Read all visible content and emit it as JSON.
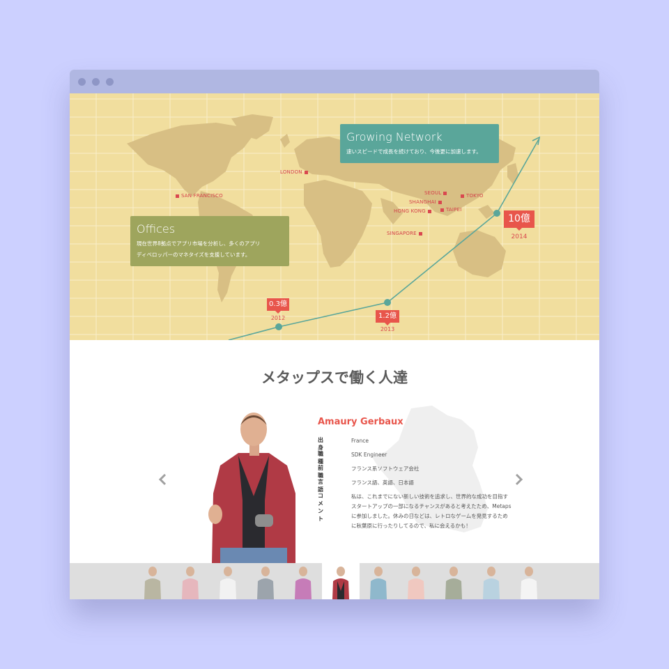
{
  "window": {
    "controls": [
      "close",
      "minimize",
      "maximize"
    ]
  },
  "hero": {
    "offices": {
      "title": "Offices",
      "desc_line1": "現在世界8拠点でアプリ市場を分析し、多くのアプリ",
      "desc_line2": "ディベロッパーのマネタイズを支援しています。"
    },
    "network": {
      "title": "Growing Network",
      "desc": "速いスピードで成長を続けており、今後更に加速します。"
    },
    "cities": [
      "LONDON",
      "SAN FRANCISCO",
      "SEOUL",
      "TOKYO",
      "SHANGHAI",
      "HONG KONG",
      "TAIPEI",
      "SINGAPORE"
    ],
    "growth": [
      {
        "value": "0.3億",
        "year": "2012"
      },
      {
        "value": "1.2億",
        "year": "2013"
      },
      {
        "value": "10億",
        "year": "2014"
      }
    ]
  },
  "team": {
    "title": "メタップスで働く人達",
    "member": {
      "name": "Amaury Gerbaux",
      "fields": [
        {
          "label": "出身",
          "value": "France"
        },
        {
          "label": "職種",
          "value": "SDK Engineer"
        },
        {
          "label": "前職",
          "value": "フランス系ソフトウェア会社"
        },
        {
          "label": "言語",
          "value": "フランス語、英語、日本語"
        },
        {
          "label": "コメント",
          "value": "私は、これまでにない新しい技術を追求し、世界的な成功を目指すスタートアップの一部になるチャンスがあると考えたため、Metapsに参加しました。休みの日などは、レトロなゲームを発見するために秋葉原に行ったりしてるので、私に会えるかも！"
        }
      ]
    },
    "nav": {
      "prev_icon": "chevron-left-icon",
      "next_icon": "chevron-right-icon"
    },
    "thumbnails": [
      "team-member",
      "team-member",
      "team-member",
      "team-member",
      "team-member",
      "team-member",
      "team-member",
      "team-member",
      "team-member",
      "team-member",
      "team-member"
    ],
    "active_thumbnail": 5
  },
  "colors": {
    "background": "#ccd0ff",
    "map_bg": "#f1de9e",
    "land": "#d8bf84",
    "offices_box": "#9ea55d",
    "network_box": "#5aa69a",
    "accent": "#e8554b",
    "line": "#5aa69a"
  }
}
